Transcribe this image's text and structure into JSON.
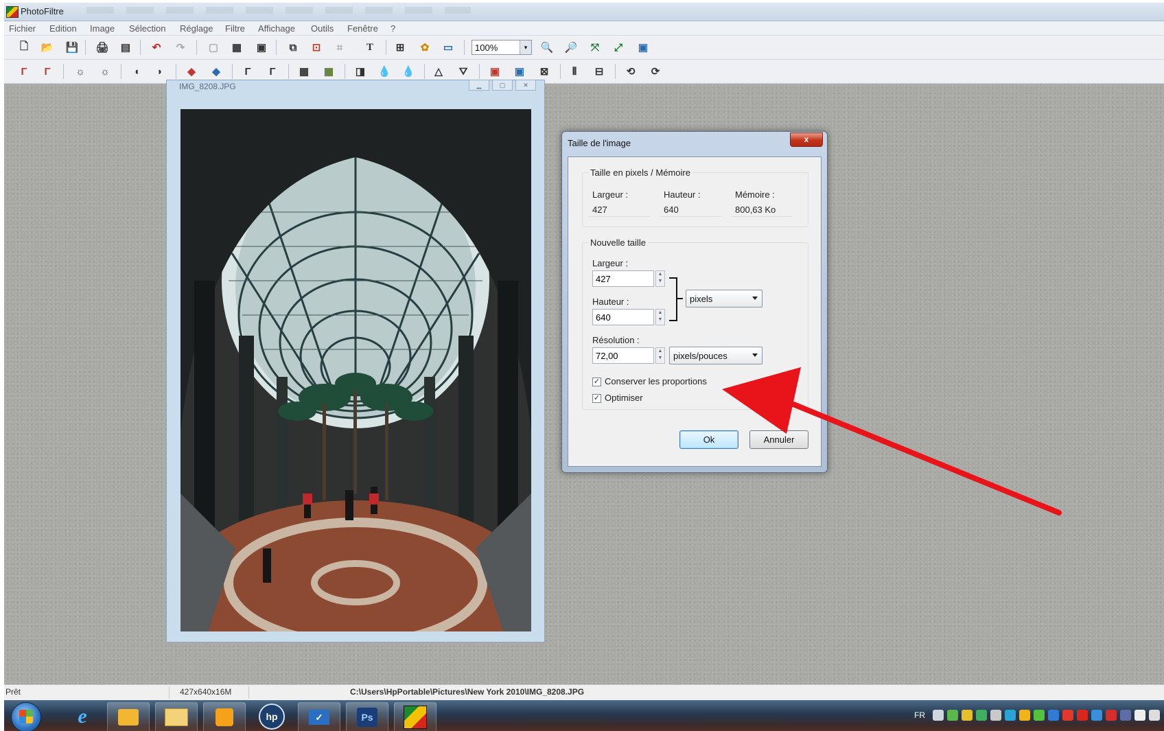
{
  "app": {
    "title": "PhotoFiltre"
  },
  "menu": [
    "Fichier",
    "Edition",
    "Image",
    "Sélection",
    "Réglage",
    "Filtre",
    "Affichage",
    "Outils",
    "Fenêtre",
    "?"
  ],
  "toolbar": {
    "zoom": "100%"
  },
  "image_window": {
    "title": "IMG_8208.JPG",
    "controls": [
      "minimize-icon",
      "maximize-icon",
      "close-icon"
    ]
  },
  "dialog": {
    "title": "Taille de l'image",
    "close_label": "x",
    "current": {
      "group_label": "Taille en pixels / Mémoire",
      "width_label": "Largeur :",
      "width_value": "427",
      "height_label": "Hauteur :",
      "height_value": "640",
      "memory_label": "Mémoire :",
      "memory_value": "800,63 Ko"
    },
    "new_size": {
      "group_label": "Nouvelle taille",
      "width_label": "Largeur :",
      "width_value": "427",
      "height_label": "Hauteur :",
      "height_value": "640",
      "unit": "pixels",
      "resolution_label": "Résolution :",
      "resolution_value": "72,00",
      "resolution_unit": "pixels/pouces"
    },
    "keep_ratio": {
      "label": "Conserver les proportions",
      "checked": true
    },
    "optimize": {
      "label": "Optimiser",
      "checked": true
    },
    "ok_label": "Ok",
    "cancel_label": "Annuler"
  },
  "annotation": {
    "arrow_color": "#e8141a"
  },
  "statusbar": {
    "state": "Prêt",
    "info": "427x640x16M",
    "path": "C:\\Users\\HpPortable\\Pictures\\New York 2010\\IMG_8208.JPG"
  },
  "taskbar": {
    "apps": [
      "start-orb",
      "internet-explorer-icon",
      "outlook-icon",
      "file-explorer-icon",
      "media-player-icon",
      "hp-icon",
      "checkmark-app-icon",
      "Ps",
      "photofiltre-icon"
    ],
    "tray_language": "FR"
  },
  "colors": {
    "accent": "#3c7fb1",
    "close": "#c6321b",
    "workspace": "#a9aaa6"
  }
}
